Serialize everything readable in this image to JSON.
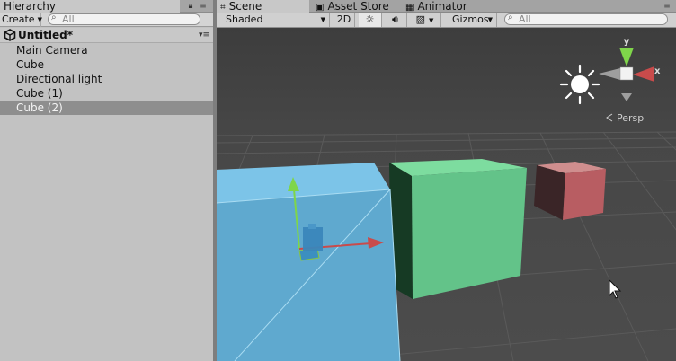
{
  "hierarchy": {
    "tab_label": "Hierarchy",
    "create_label": "Create",
    "search_placeholder": "All",
    "scene_name": "Untitled*",
    "items": [
      {
        "label": "Main Camera",
        "selected": false
      },
      {
        "label": "Cube",
        "selected": false
      },
      {
        "label": "Directional light",
        "selected": false
      },
      {
        "label": "Cube (1)",
        "selected": false
      },
      {
        "label": "Cube (2)",
        "selected": true
      }
    ]
  },
  "scene_tabs": [
    {
      "label": "Scene",
      "icon": "scene-grid-icon",
      "active": true
    },
    {
      "label": "Asset Store",
      "icon": "asset-store-icon",
      "active": false
    },
    {
      "label": "Animator",
      "icon": "animator-icon",
      "active": false
    }
  ],
  "scene_toolbar": {
    "shading_mode": "Shaded",
    "mode_2d_label": "2D",
    "gizmos_label": "Gizmos",
    "search_placeholder": "All"
  },
  "viewport": {
    "perspective_label": "Persp",
    "orientation_labels": {
      "y": "y",
      "x": "x"
    },
    "colors": {
      "background": "#474747",
      "cube_blue": "#5fa9cf",
      "cube_green": "#63c389",
      "cube_red": "#b85d62",
      "gizmo_x": "#c94b4b",
      "gizmo_y": "#7fd54a",
      "sun": "#ffffff"
    }
  }
}
